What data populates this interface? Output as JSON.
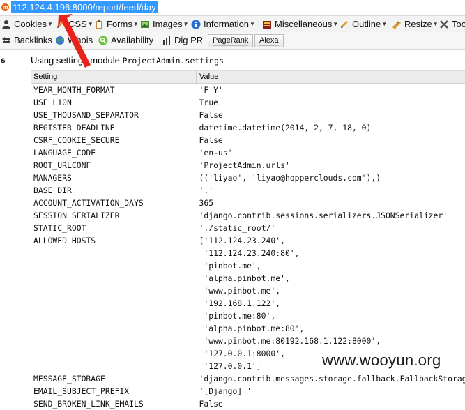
{
  "browser": {
    "url": "112.124.4.196:8000/report/feed/day"
  },
  "toolbar1": {
    "items": [
      {
        "label": "Cookies",
        "icon": "person-icon"
      },
      {
        "label": "CSS",
        "icon": "pencil-icon"
      },
      {
        "label": "Forms",
        "icon": "clipboard-icon"
      },
      {
        "label": "Images",
        "icon": "image-icon"
      },
      {
        "label": "Information",
        "icon": "info-icon"
      },
      {
        "label": "Miscellaneous",
        "icon": "misc-icon"
      },
      {
        "label": "Outline",
        "icon": "pen-icon"
      },
      {
        "label": "Resize",
        "icon": "ruler-icon"
      },
      {
        "label": "Too",
        "icon": "tools-icon"
      }
    ]
  },
  "toolbar2": {
    "items": [
      {
        "label": "Backlinks",
        "icon": "backlinks-icon"
      },
      {
        "label": "Whois",
        "icon": "globe-icon"
      },
      {
        "label": "Availability",
        "icon": "magnifier-icon"
      },
      {
        "label": "Dig PR",
        "icon": "bars-icon"
      },
      {
        "label": "PageRank"
      },
      {
        "label": "Alexa"
      }
    ]
  },
  "page": {
    "left_label": "s",
    "heading_prefix": "Using settings module ",
    "heading_module": "ProjectAdmin.settings",
    "table": {
      "headers": [
        "Setting",
        "Value"
      ],
      "rows": [
        {
          "setting": "YEAR_MONTH_FORMAT",
          "value": "'F Y'"
        },
        {
          "setting": "USE_L10N",
          "value": "True"
        },
        {
          "setting": "USE_THOUSAND_SEPARATOR",
          "value": "False"
        },
        {
          "setting": "REGISTER_DEADLINE",
          "value": "datetime.datetime(2014, 2, 7, 18, 0)"
        },
        {
          "setting": "CSRF_COOKIE_SECURE",
          "value": "False"
        },
        {
          "setting": "LANGUAGE_CODE",
          "value": "'en-us'"
        },
        {
          "setting": "ROOT_URLCONF",
          "value": "'ProjectAdmin.urls'"
        },
        {
          "setting": "MANAGERS",
          "value": "(('liyao', 'liyao@hopperclouds.com'),)"
        },
        {
          "setting": "BASE_DIR",
          "value": "'.'"
        },
        {
          "setting": "ACCOUNT_ACTIVATION_DAYS",
          "value": "365"
        },
        {
          "setting": "SESSION_SERIALIZER",
          "value": "'django.contrib.sessions.serializers.JSONSerializer'"
        },
        {
          "setting": "STATIC_ROOT",
          "value": "'./static_root/'"
        },
        {
          "setting": "ALLOWED_HOSTS",
          "value": "['112.124.23.240',\n '112.124.23.240:80',\n 'pinbot.me',\n 'alpha.pinbot.me',\n 'www.pinbot.me',\n '192.168.1.122',\n 'pinbot.me:80',\n 'alpha.pinbot.me:80',\n 'www.pinbot.me:80192.168.1.122:8000',\n '127.0.0.1:8000',\n '127.0.0.1']"
        },
        {
          "setting": "MESSAGE_STORAGE",
          "value": "'django.contrib.messages.storage.fallback.FallbackStorage'"
        },
        {
          "setting": "EMAIL_SUBJECT_PREFIX",
          "value": "'[Django] '"
        },
        {
          "setting": "SEND_BROKEN_LINK_EMAILS",
          "value": "False"
        }
      ]
    }
  },
  "watermark": "www.wooyun.org",
  "colors": {
    "url_highlight": "#3399ff",
    "arrow": "#e8231b",
    "table_header_bg": "#ececec"
  }
}
